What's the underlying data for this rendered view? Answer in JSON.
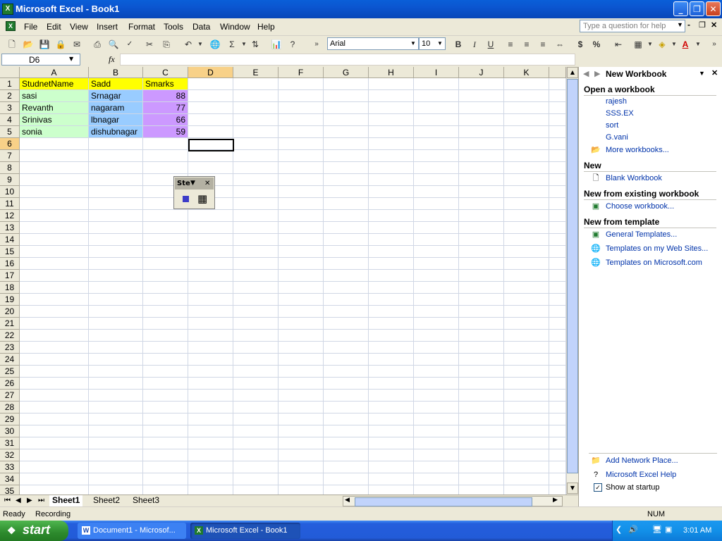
{
  "window": {
    "title": "Microsoft Excel - Book1"
  },
  "menu": {
    "items": [
      "File",
      "Edit",
      "View",
      "Insert",
      "Format",
      "Tools",
      "Data",
      "Window",
      "Help"
    ],
    "help_placeholder": "Type a question for help"
  },
  "toolbar": {
    "font": "Arial",
    "font_size": "10",
    "bold": "B",
    "italic": "I",
    "underline": "U",
    "sum": "Σ",
    "currency": "$",
    "percent": "%"
  },
  "formula_bar": {
    "name_box": "D6",
    "fx": "fx",
    "content": ""
  },
  "grid": {
    "columns": [
      "A",
      "B",
      "C",
      "D",
      "E",
      "F",
      "G",
      "H",
      "I",
      "J",
      "K"
    ],
    "selected_column": "D",
    "selected_row": "6",
    "active_cell": "D6",
    "rows": [
      "1",
      "2",
      "3",
      "4",
      "5",
      "6",
      "7",
      "8",
      "9",
      "10",
      "11",
      "12",
      "13",
      "14",
      "15",
      "16",
      "17",
      "18",
      "19",
      "20",
      "21",
      "22",
      "23",
      "24",
      "25",
      "26",
      "27",
      "28",
      "29",
      "30",
      "31",
      "32",
      "33",
      "34",
      "35"
    ],
    "header": [
      "StudnetName",
      "Sadd",
      "Smarks"
    ],
    "data": [
      [
        "sasi",
        "Srnagar",
        "88"
      ],
      [
        "Revanth",
        "nagaram",
        "77"
      ],
      [
        "Srinivas",
        "lbnagar",
        "66"
      ],
      [
        "sonia",
        "dishubnagar",
        "59"
      ]
    ],
    "colors": {
      "header_fill": "#ffff00",
      "name_fill": "#ccffcc",
      "address_fill": "#99ccff",
      "marks_fill": "#cc99ff"
    }
  },
  "floating_toolbar": {
    "title": "Ste"
  },
  "sheets": {
    "tabs": [
      "Sheet1",
      "Sheet2",
      "Sheet3"
    ],
    "active": "Sheet1"
  },
  "task_pane": {
    "title": "New Workbook",
    "open_heading": "Open a workbook",
    "recent": [
      "rajesh",
      "SSS.EX",
      "sort",
      "G.vani"
    ],
    "more": "More workbooks...",
    "new_heading": "New",
    "blank": "Blank Workbook",
    "existing_heading": "New from existing workbook",
    "choose": "Choose workbook...",
    "template_heading": "New from template",
    "general": "General Templates...",
    "web_sites": "Templates on my Web Sites...",
    "ms_com": "Templates on Microsoft.com",
    "network": "Add Network Place...",
    "help": "Microsoft Excel Help",
    "startup": "Show at startup"
  },
  "status": {
    "ready": "Ready",
    "recording": "Recording",
    "num": "NUM"
  },
  "taskbar": {
    "start": "start",
    "tasks": [
      "Document1 - Microsof...",
      "Microsoft Excel - Book1"
    ],
    "time": "3:01 AM"
  }
}
